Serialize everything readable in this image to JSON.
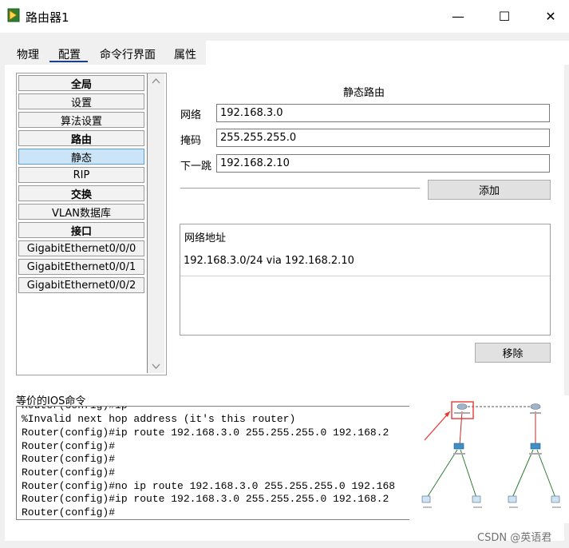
{
  "window": {
    "title": "路由器1",
    "minimize_label": "—",
    "maximize_label": "☐",
    "close_label": "✕"
  },
  "tabs": [
    "物理",
    "配置",
    "命令行界面",
    "属性"
  ],
  "nav": {
    "items": [
      {
        "label": "全局",
        "type": "header"
      },
      {
        "label": "设置",
        "type": "item"
      },
      {
        "label": "算法设置",
        "type": "item"
      },
      {
        "label": "路由",
        "type": "header"
      },
      {
        "label": "静态",
        "type": "selected"
      },
      {
        "label": "RIP",
        "type": "item"
      },
      {
        "label": "交换",
        "type": "header"
      },
      {
        "label": "VLAN数据库",
        "type": "item"
      },
      {
        "label": "接口",
        "type": "header"
      },
      {
        "label": "GigabitEthernet0/0/0",
        "type": "item"
      },
      {
        "label": "GigabitEthernet0/0/1",
        "type": "item"
      },
      {
        "label": "GigabitEthernet0/0/2",
        "type": "item"
      }
    ]
  },
  "static_route": {
    "title": "静态路由",
    "network_label": "网络",
    "network_value": "192.168.3.0",
    "mask_label": "掩码",
    "mask_value": "255.255.255.0",
    "nexthop_label": "下一跳",
    "nexthop_value": "192.168.2.10",
    "add_button": "添加",
    "list_header": "网络地址",
    "routes": [
      "192.168.3.0/24 via 192.168.2.10"
    ],
    "remove_button": "移除"
  },
  "ios": {
    "label": "等价的IOS命令",
    "lines": [
      "%Invalid next hop address (it's this router)",
      "Router(config)#ip route 192.168.3.0 255.255.255.0 192.168.2",
      "Router(config)#",
      "Router(config)#",
      "Router(config)#",
      "Router(config)#no ip route 192.168.3.0 255.255.255.0 192.168",
      "Router(config)#ip route 192.168.3.0 255.255.255.0 192.168.2",
      "Router(config)#"
    ]
  },
  "watermark": "CSDN @英语君",
  "colors": {
    "accent": "#1b3e8c",
    "selection": "#cce4f7",
    "highlight": "#e53935",
    "link_dash": "#555555"
  }
}
